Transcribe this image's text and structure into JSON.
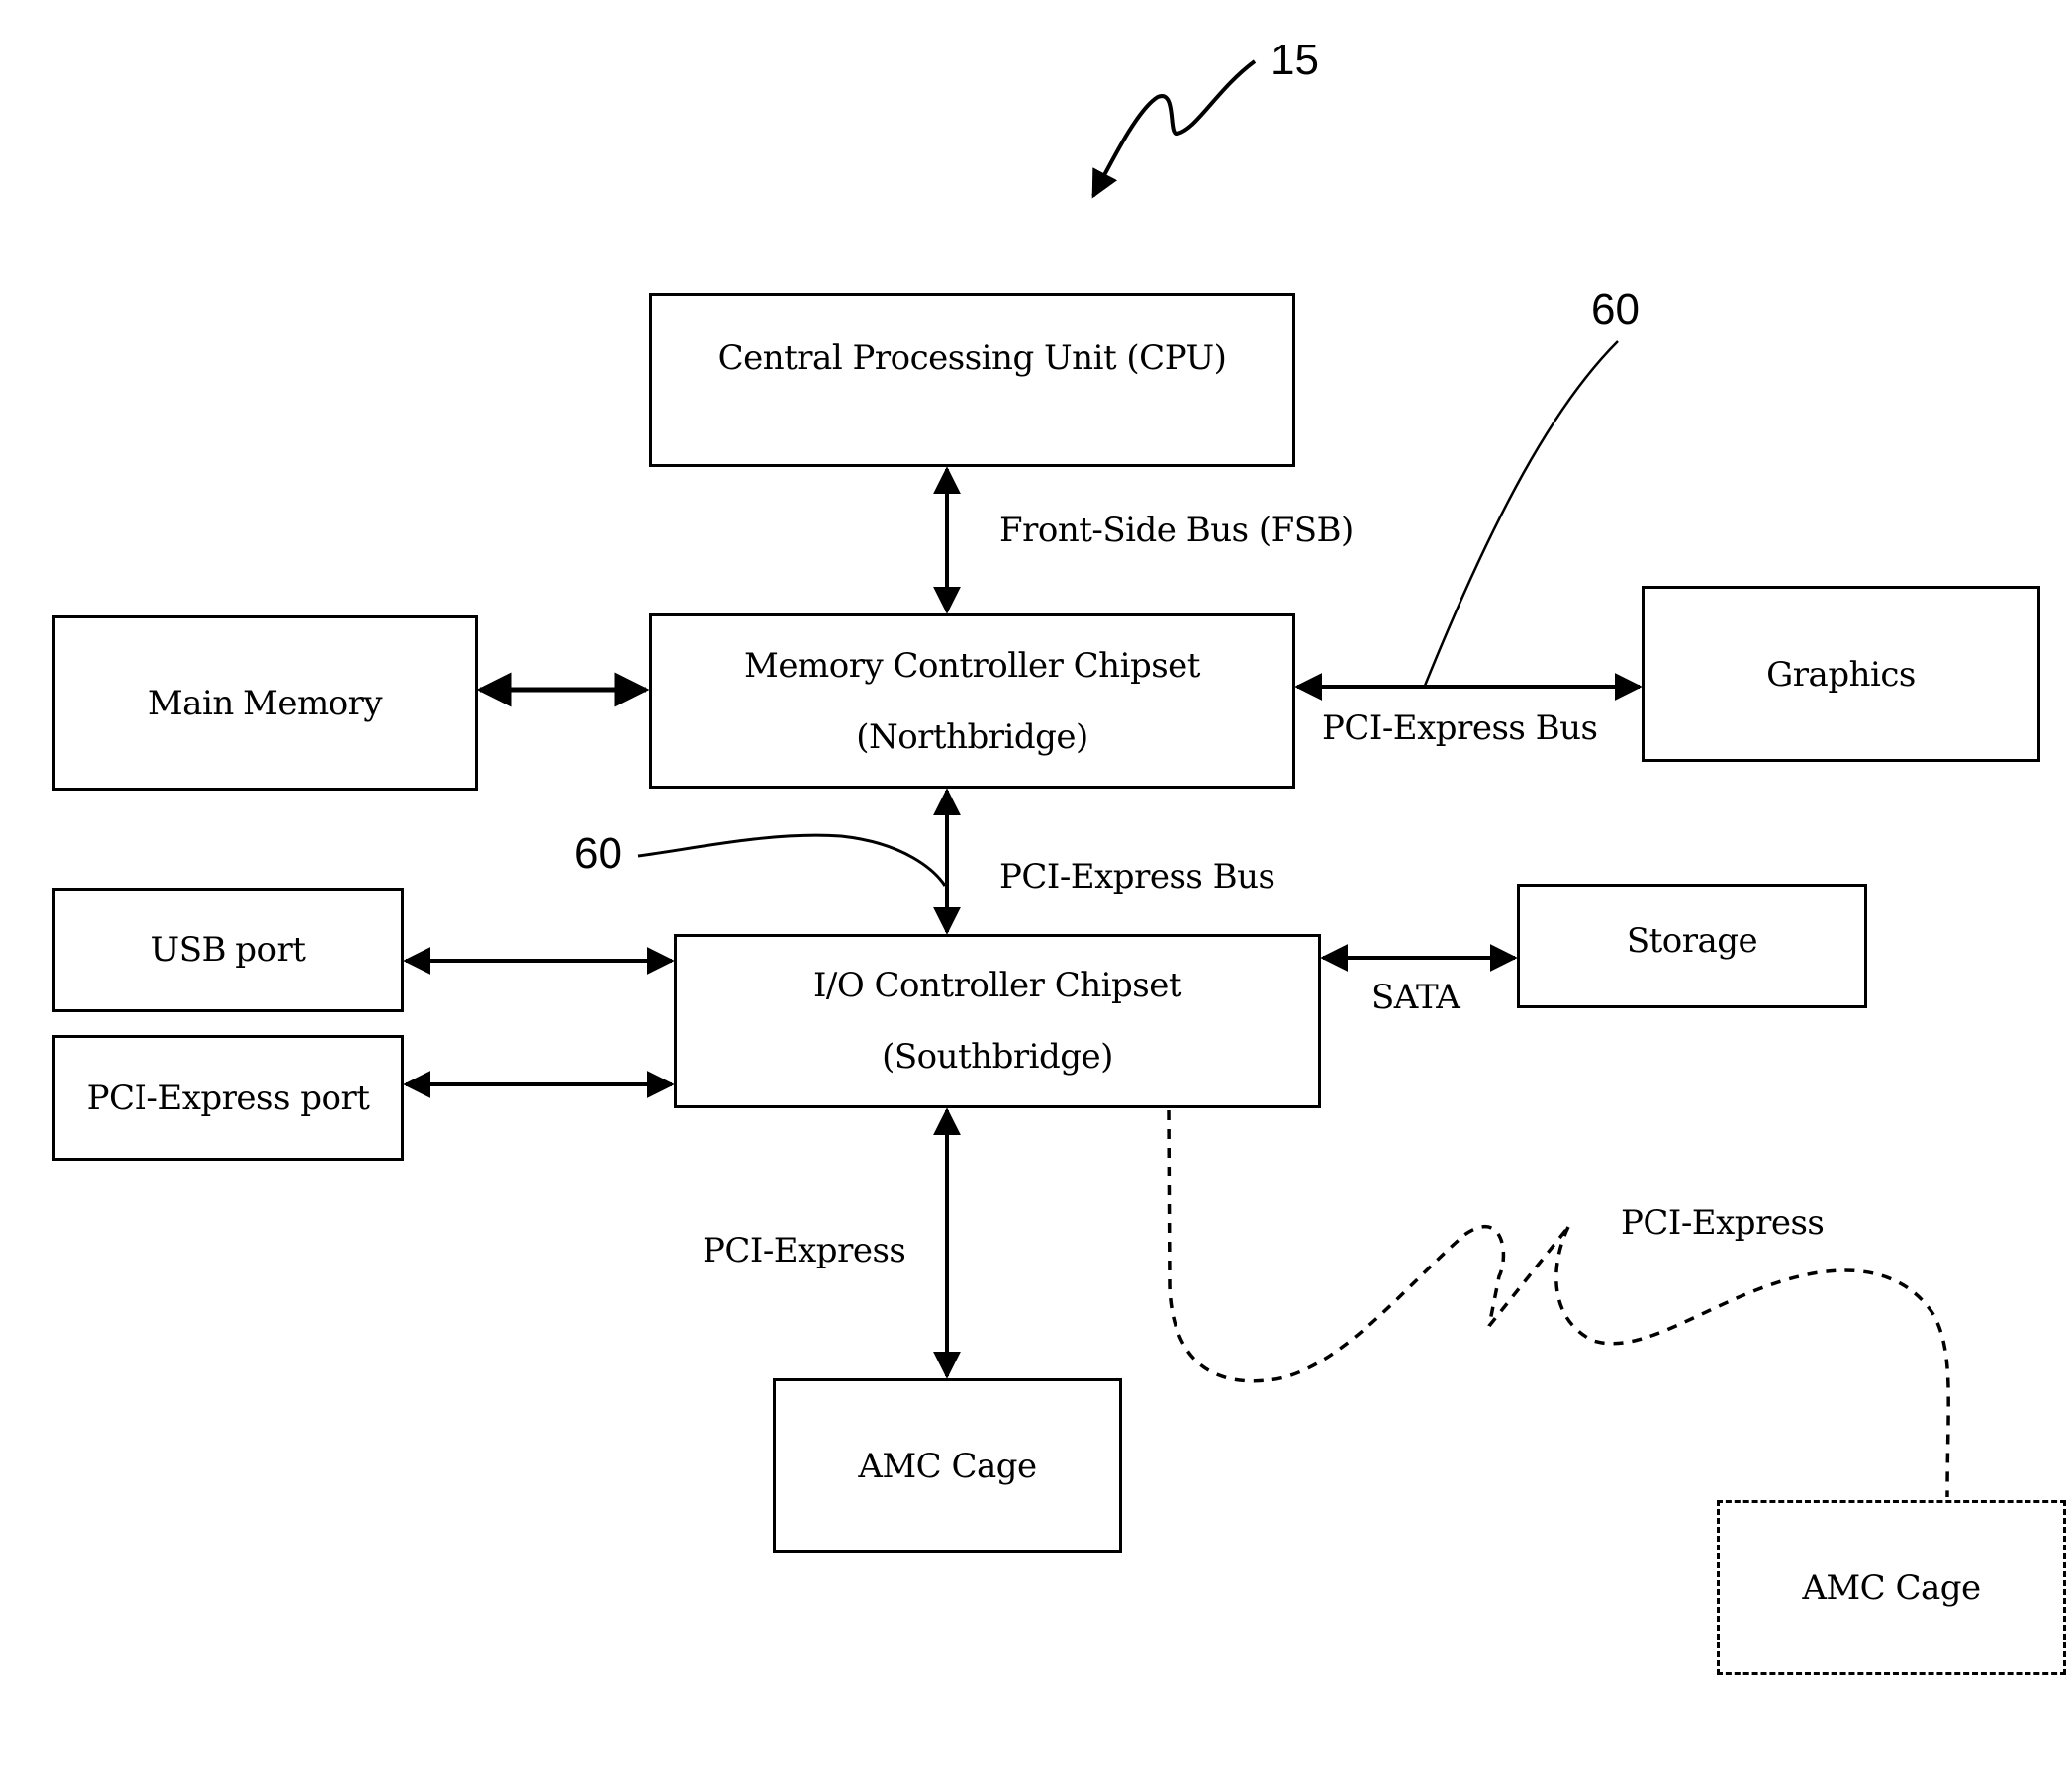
{
  "figure": {
    "reference_number": "15",
    "leader_refs": [
      "60",
      "60"
    ]
  },
  "components": {
    "cpu": "Central Processing Unit (CPU)",
    "northbridge": {
      "line1": "Memory Controller Chipset",
      "line2": "(Northbridge)"
    },
    "main_memory": "Main Memory",
    "graphics": "Graphics",
    "southbridge": {
      "line1": "I/O Controller Chipset",
      "line2": "(Southbridge)"
    },
    "usb_port": "USB port",
    "pcie_port": "PCI-Express port",
    "storage": "Storage",
    "amc_cage_local": "AMC Cage",
    "amc_cage_remote": "AMC Cage"
  },
  "connections": {
    "fsb": "Front-Side Bus (FSB)",
    "nb_graphics": "PCI-Express Bus",
    "nb_sb": "PCI-Express Bus",
    "sata": "SATA",
    "sb_amc_local": "PCI-Express",
    "sb_amc_remote": "PCI-Express"
  }
}
